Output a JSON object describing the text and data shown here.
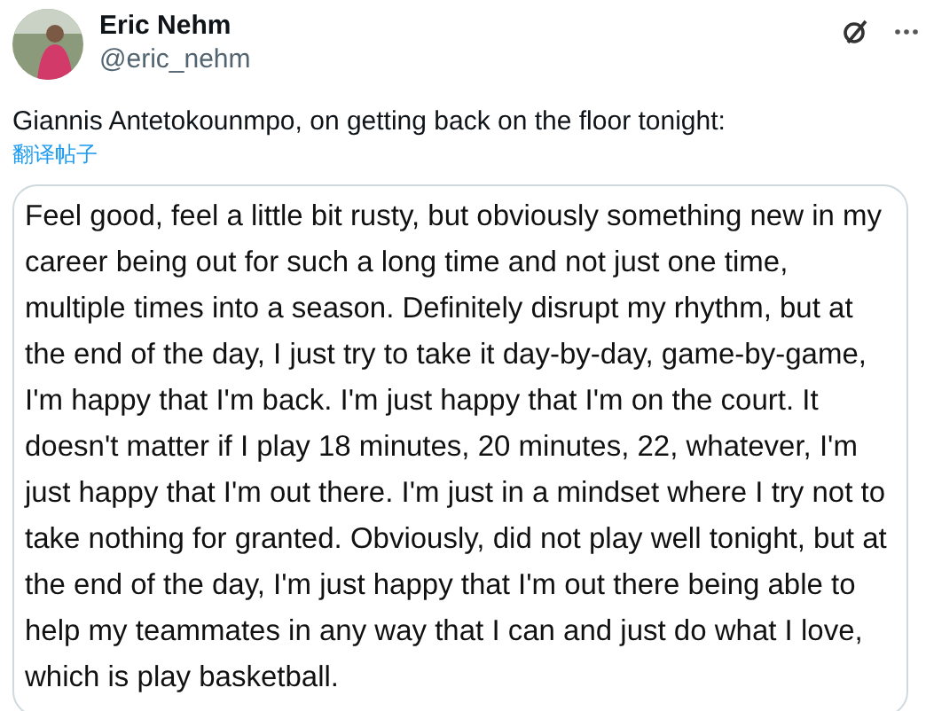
{
  "author": {
    "name": "Eric Nehm",
    "handle": "@eric_nehm"
  },
  "tweet_text": "Giannis Antetokounmpo, on getting back on the floor tonight:",
  "translate_link": "翻译帖子",
  "quote_image_text": "Feel good, feel a little bit rusty, but obviously something new in my\ncareer being out for such a long time and not just one time,\nmultiple times into a season. Definitely disrupt my rhythm, but at\nthe end of the day, I just try to take it day-by-day, game-by-game,\nI'm happy that I'm back. I'm just happy that I'm on the court. It\ndoesn't matter if I play 18 minutes, 20 minutes, 22, whatever, I'm\njust happy that I'm out there. I'm just in a mindset where I try not to\ntake nothing for granted. Obviously, did not play well tonight, but at\nthe end of the day, I'm just happy that I'm out there being able to\nhelp my teammates in any way that I can and just do what I love,\nwhich is play basketball."
}
